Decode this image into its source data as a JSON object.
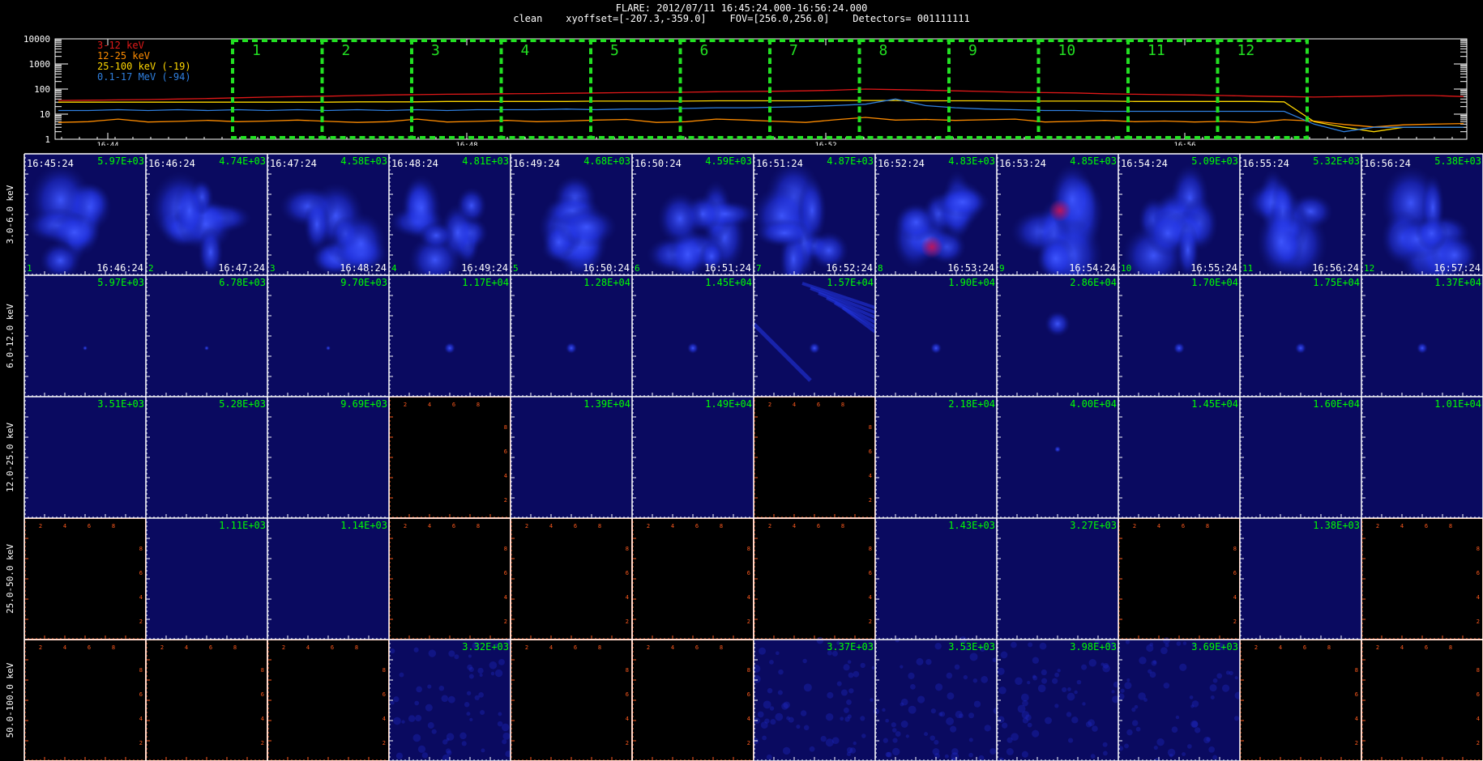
{
  "header": {
    "line1": "FLARE: 2012/07/11 16:45:24.000-16:56:24.000",
    "line2": "clean    xyoffset=[-207.3,-359.0]    FOV=[256.0,256.0]    Detectors= 001111111"
  },
  "chart_data": [
    {
      "type": "line",
      "ylog": true,
      "yticks": [
        "10000",
        "1000",
        "100",
        "10",
        "1"
      ],
      "xticks": [
        "16:44",
        "16:48",
        "16:52",
        "16:56"
      ],
      "legend_placement": "top-left",
      "series": [
        {
          "name": "3-12 keV",
          "color": "#e01818",
          "values": [
            35,
            36,
            37,
            38,
            40,
            42,
            45,
            48,
            50,
            52,
            55,
            58,
            60,
            62,
            63,
            65,
            66,
            68,
            70,
            72,
            74,
            75,
            78,
            80,
            82,
            85,
            90,
            100,
            95,
            90,
            85,
            80,
            75,
            72,
            70,
            65,
            62,
            60,
            58,
            55,
            52,
            50,
            48,
            50,
            52,
            55,
            55,
            50
          ]
        },
        {
          "name": "12-25 keV",
          "color": "#ff8c00",
          "values": [
            5,
            5,
            6,
            5,
            5,
            6,
            5,
            5,
            6,
            5,
            5,
            5,
            6,
            5,
            5,
            6,
            5,
            5,
            6,
            6,
            5,
            5,
            6,
            6,
            5,
            5,
            6,
            7,
            6,
            6,
            6,
            6,
            6,
            5,
            5,
            6,
            5,
            5,
            5,
            5,
            5,
            6,
            5,
            4,
            3,
            4,
            4,
            4
          ]
        },
        {
          "name": "25-100 keV (-19)",
          "color": "#ffd700",
          "values": [
            30,
            30,
            30,
            30,
            30,
            30,
            30,
            30,
            30,
            30,
            31,
            31,
            31,
            32,
            32,
            32,
            32,
            32,
            33,
            33,
            33,
            33,
            34,
            34,
            34,
            34,
            35,
            35,
            35,
            34,
            34,
            34,
            33,
            33,
            33,
            33,
            32,
            32,
            32,
            32,
            32,
            31,
            5,
            3,
            2,
            3,
            3,
            3
          ]
        },
        {
          "name": "0.1-17 MeV (-94)",
          "color": "#2f7fdf",
          "values": [
            14,
            14,
            15,
            14,
            15,
            14,
            15,
            14,
            15,
            14,
            15,
            14,
            15,
            14,
            15,
            15,
            15,
            16,
            15,
            16,
            16,
            17,
            18,
            18,
            19,
            20,
            22,
            25,
            40,
            22,
            18,
            16,
            15,
            14,
            14,
            13,
            13,
            13,
            13,
            13,
            13,
            13,
            4,
            2,
            3,
            3,
            3,
            3
          ]
        }
      ],
      "intervals": [
        "1",
        "2",
        "3",
        "4",
        "5",
        "6",
        "7",
        "8",
        "9",
        "10",
        "11",
        "12"
      ]
    },
    {
      "type": "heatmap",
      "energy_bands": [
        "3.0-6.0 keV",
        "6.0-12.0 keV",
        "12.0-25.0 keV",
        "25.0-50.0 keV",
        "50.0-100.0 keV"
      ],
      "start_times": [
        "16:45:24",
        "16:46:24",
        "16:47:24",
        "16:48:24",
        "16:49:24",
        "16:50:24",
        "16:51:24",
        "16:52:24",
        "16:53:24",
        "16:54:24",
        "16:55:24",
        "16:56:24"
      ],
      "end_times": [
        "16:46:24",
        "16:47:24",
        "16:48:24",
        "16:49:24",
        "16:50:24",
        "16:51:24",
        "16:52:24",
        "16:53:24",
        "16:54:24",
        "16:55:24",
        "16:56:24",
        "16:57:24"
      ],
      "interval_numbers": [
        "1",
        "2",
        "3",
        "4",
        "5",
        "6",
        "7",
        "8",
        "9",
        "10",
        "11",
        "12"
      ],
      "max_values": [
        [
          "5.97E+03",
          "4.74E+03",
          "4.58E+03",
          "4.81E+03",
          "4.68E+03",
          "4.59E+03",
          "4.87E+03",
          "4.83E+03",
          "4.85E+03",
          "5.09E+03",
          "5.32E+03",
          "5.38E+03"
        ],
        [
          "5.97E+03",
          "6.78E+03",
          "9.70E+03",
          "1.17E+04",
          "1.28E+04",
          "1.45E+04",
          "1.57E+04",
          "1.90E+04",
          "2.86E+04",
          "1.70E+04",
          "1.75E+04",
          "1.37E+04"
        ],
        [
          "3.51E+03",
          "5.28E+03",
          "9.69E+03",
          "",
          "1.39E+04",
          "1.49E+04",
          "",
          "2.18E+04",
          "4.00E+04",
          "1.45E+04",
          "1.60E+04",
          "1.01E+04"
        ],
        [
          "",
          "1.11E+03",
          "1.14E+03",
          "",
          "",
          "",
          "",
          "1.43E+03",
          "3.27E+03",
          "",
          "1.38E+03",
          ""
        ],
        [
          "",
          "",
          "",
          "3.32E+03",
          "",
          "",
          "3.37E+03",
          "3.53E+03",
          "3.98E+03",
          "3.69E+03",
          "",
          ""
        ]
      ],
      "empty_axis_ticks": [
        "2",
        "4",
        "6",
        "8"
      ],
      "colors": {
        "grid": "#ffffff",
        "empty_axes": "#ff5a1e",
        "label": "#00ff00",
        "image": "#0a0a60",
        "source": "#2638ff",
        "hot": "#b01050"
      }
    }
  ]
}
